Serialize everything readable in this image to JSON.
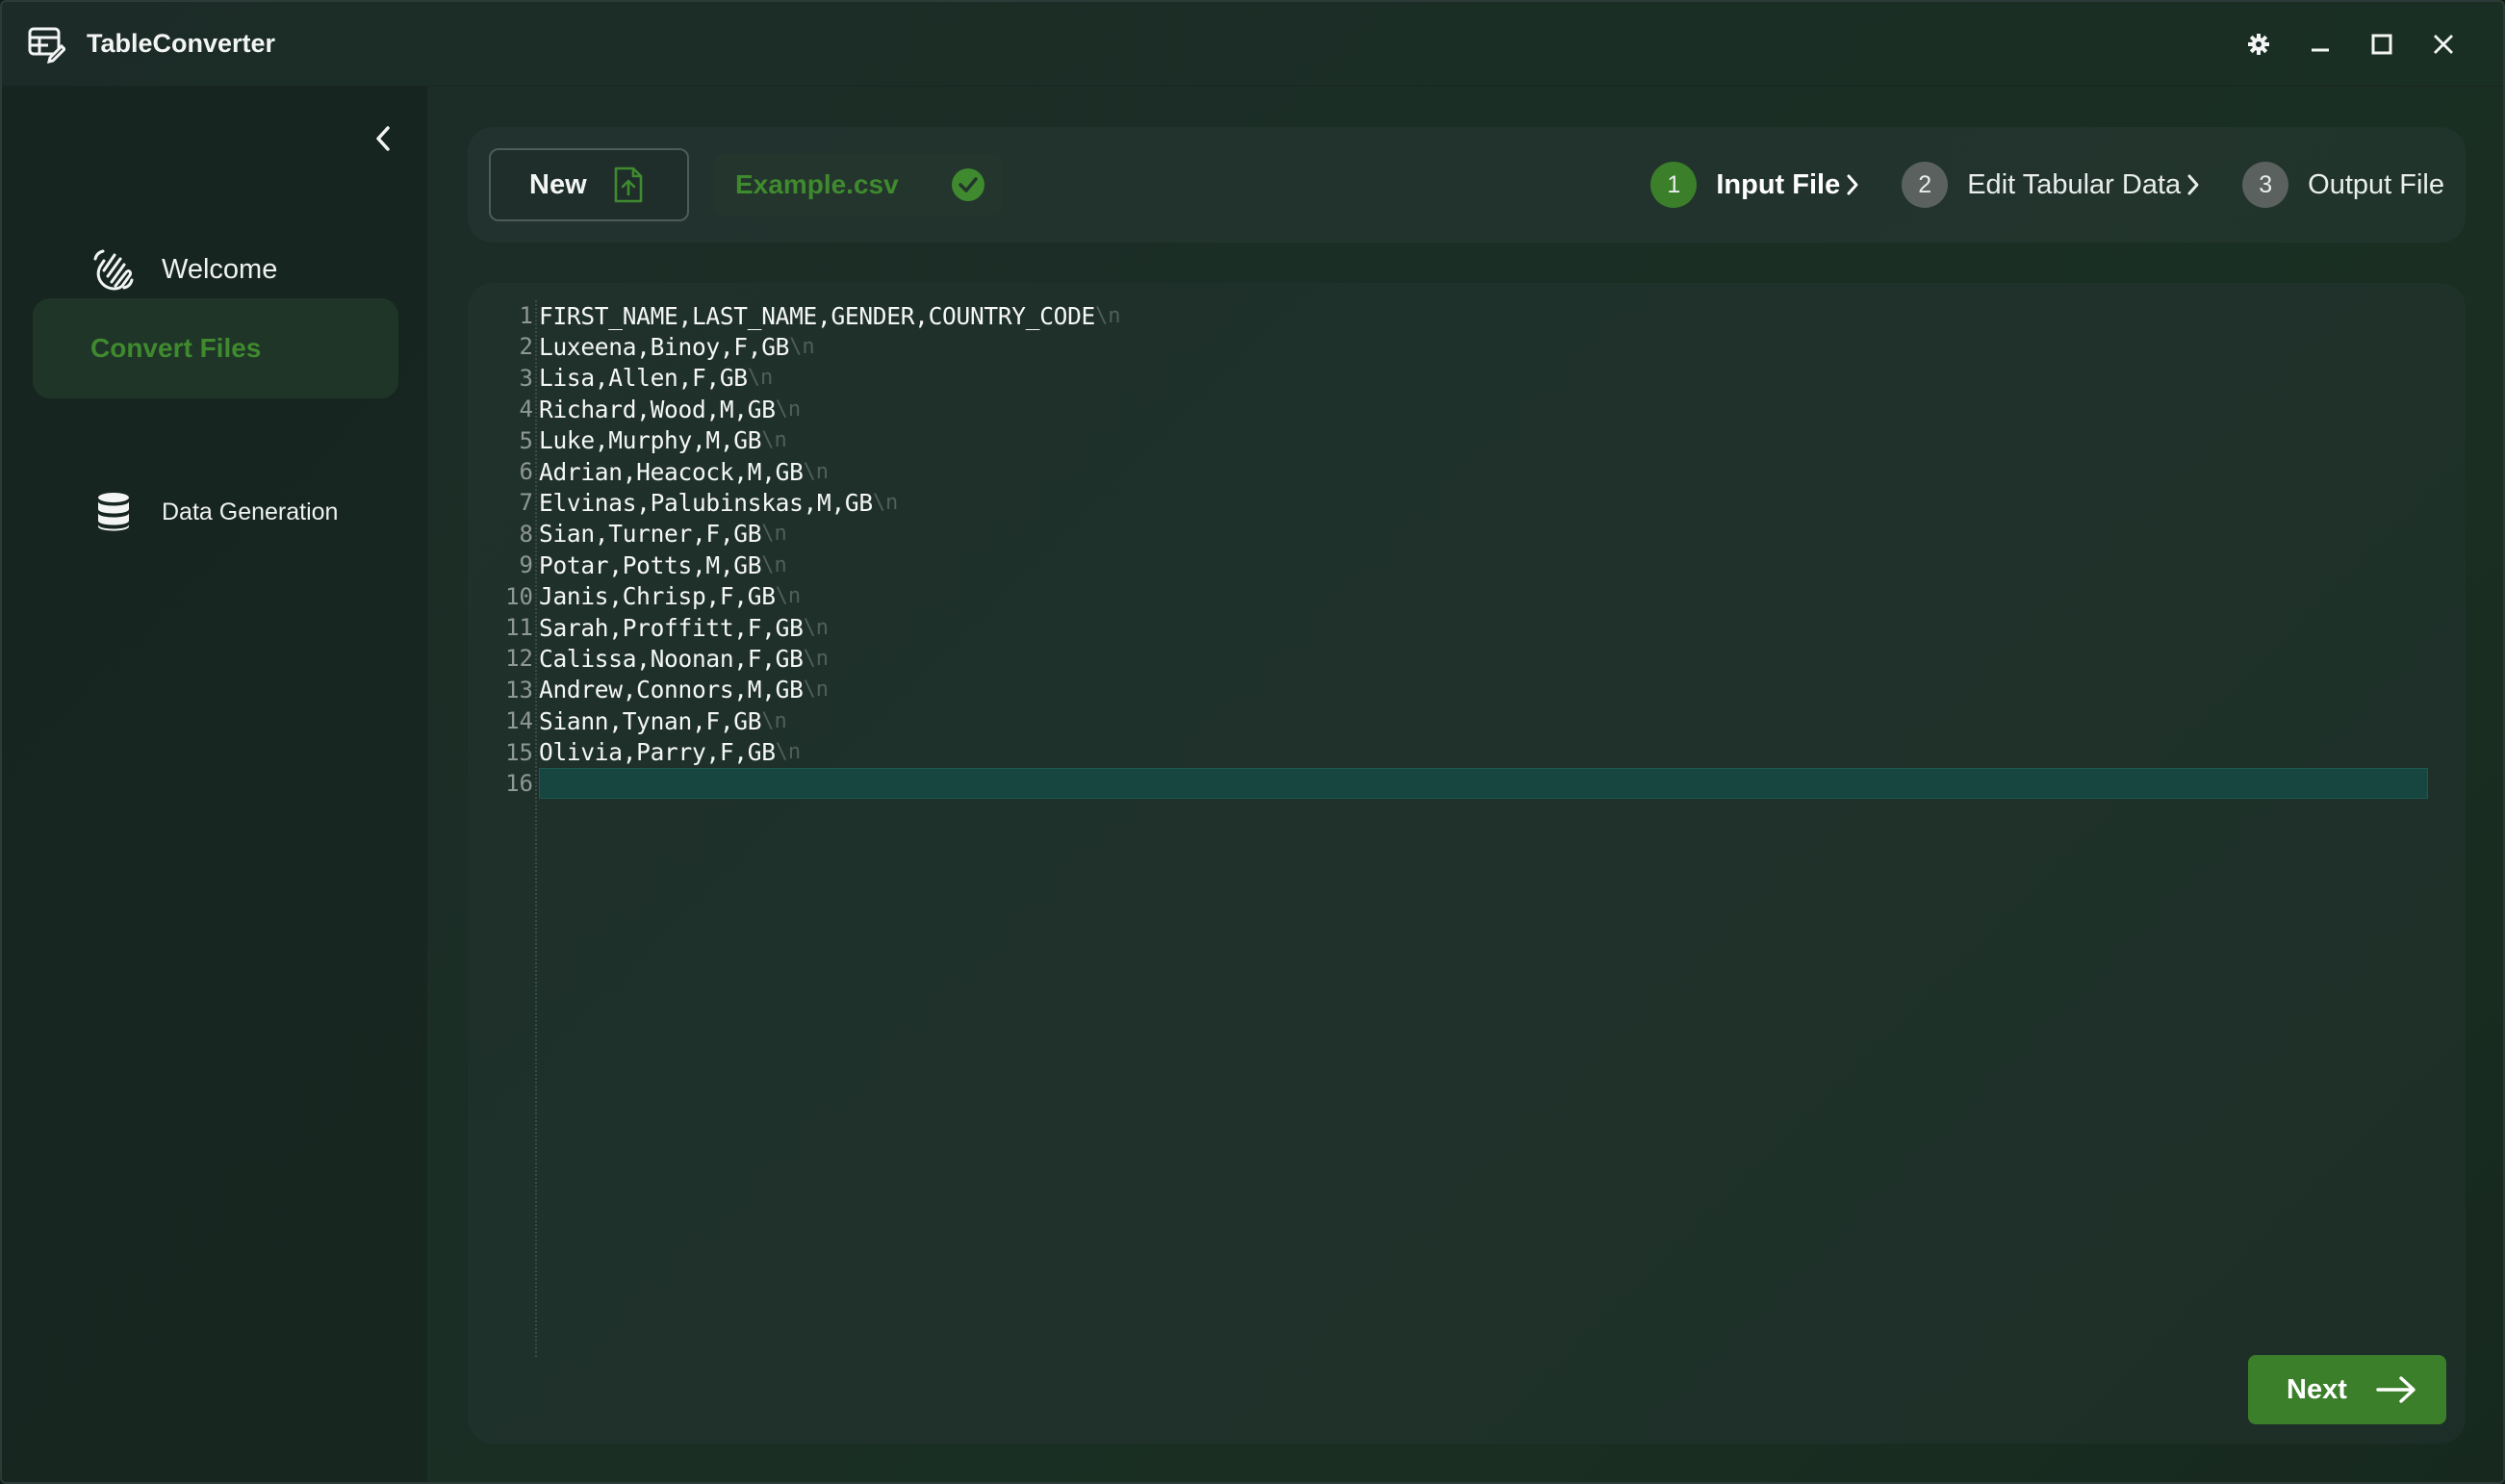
{
  "app": {
    "title": "TableConverter"
  },
  "sidebar": {
    "items": [
      {
        "label": "Welcome",
        "icon": "waving-hand-icon",
        "active": false
      },
      {
        "label": "Convert Files",
        "icon": "",
        "active": true
      },
      {
        "label": "Data Generation",
        "icon": "database-icon",
        "active": false
      }
    ]
  },
  "header": {
    "new_label": "New",
    "file_name": "Example.csv",
    "steps": [
      {
        "num": "1",
        "label": "Input File",
        "active": true
      },
      {
        "num": "2",
        "label": "Edit Tabular Data",
        "active": false
      },
      {
        "num": "3",
        "label": "Output File",
        "active": false
      }
    ]
  },
  "editor": {
    "eol_marker": "\\n",
    "current_line": 16,
    "lines": [
      {
        "n": "1",
        "text": "FIRST_NAME,LAST_NAME,GENDER,COUNTRY_CODE"
      },
      {
        "n": "2",
        "text": "Luxeena,Binoy,F,GB"
      },
      {
        "n": "3",
        "text": "Lisa,Allen,F,GB"
      },
      {
        "n": "4",
        "text": "Richard,Wood,M,GB"
      },
      {
        "n": "5",
        "text": "Luke,Murphy,M,GB"
      },
      {
        "n": "6",
        "text": "Adrian,Heacock,M,GB"
      },
      {
        "n": "7",
        "text": "Elvinas,Palubinskas,M,GB"
      },
      {
        "n": "8",
        "text": "Sian,Turner,F,GB"
      },
      {
        "n": "9",
        "text": "Potar,Potts,M,GB"
      },
      {
        "n": "10",
        "text": "Janis,Chrisp,F,GB"
      },
      {
        "n": "11",
        "text": "Sarah,Proffitt,F,GB"
      },
      {
        "n": "12",
        "text": "Calissa,Noonan,F,GB"
      },
      {
        "n": "13",
        "text": "Andrew,Connors,M,GB"
      },
      {
        "n": "14",
        "text": "Siann,Tynan,F,GB"
      },
      {
        "n": "15",
        "text": "Olivia,Parry,F,GB"
      },
      {
        "n": "16",
        "text": ""
      }
    ]
  },
  "footer": {
    "next_label": "Next"
  },
  "colors": {
    "accent": "#3b7f2a",
    "accent_text": "#3f8a2f",
    "background": "#1b2e25",
    "line_highlight": "#16463f"
  }
}
